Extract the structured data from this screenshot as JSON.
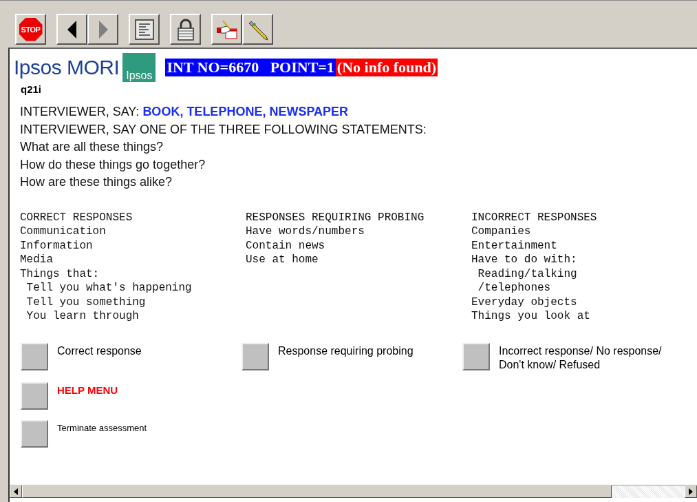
{
  "toolbar": {
    "stop_label": "STOP",
    "back_disabled": false,
    "forward_disabled": true
  },
  "header": {
    "logo_text": "Ipsos MORI",
    "logo_badge": "Ipsos",
    "int_no": "INT NO=6670   POINT=1",
    "status": "(No info found)"
  },
  "question_id": "q21i",
  "instructions": [
    {
      "text": "INTERVIEWER, SAY: **BOOK, TELEPHONE, NEWSPAPER**"
    },
    {
      "text": "INTERVIEWER, SAY ONE OF THE THREE FOLLOWING STATEMENTS:"
    },
    {
      "text": "What are all these things?"
    },
    {
      "text": "How do these things go together?"
    },
    {
      "text": "How are these things alike?"
    }
  ],
  "response_columns": [
    {
      "heading": "CORRECT RESPONSES",
      "lines": [
        "Communication",
        "Information",
        "Media",
        "Things that:",
        " Tell you what's happening",
        " Tell you something",
        " You learn through"
      ]
    },
    {
      "heading": "RESPONSES REQUIRING PROBING",
      "lines": [
        "Have words/numbers",
        "Contain news",
        "Use at home"
      ]
    },
    {
      "heading": "INCORRECT RESPONSES",
      "lines": [
        "Companies",
        "Entertainment",
        "Have to do with:",
        " Reading/talking",
        " /telephones",
        "Everyday objects",
        "Things you look at"
      ]
    }
  ],
  "options": [
    {
      "kind": "answer",
      "label": "Correct response"
    },
    {
      "kind": "answer",
      "label": "Response requiring probing"
    },
    {
      "kind": "answer",
      "label": "Incorrect response/ No response/ Don't know/ Refused"
    },
    {
      "kind": "help",
      "label": "HELP MENU"
    },
    {
      "kind": "small",
      "label": "Terminate assessment"
    }
  ]
}
